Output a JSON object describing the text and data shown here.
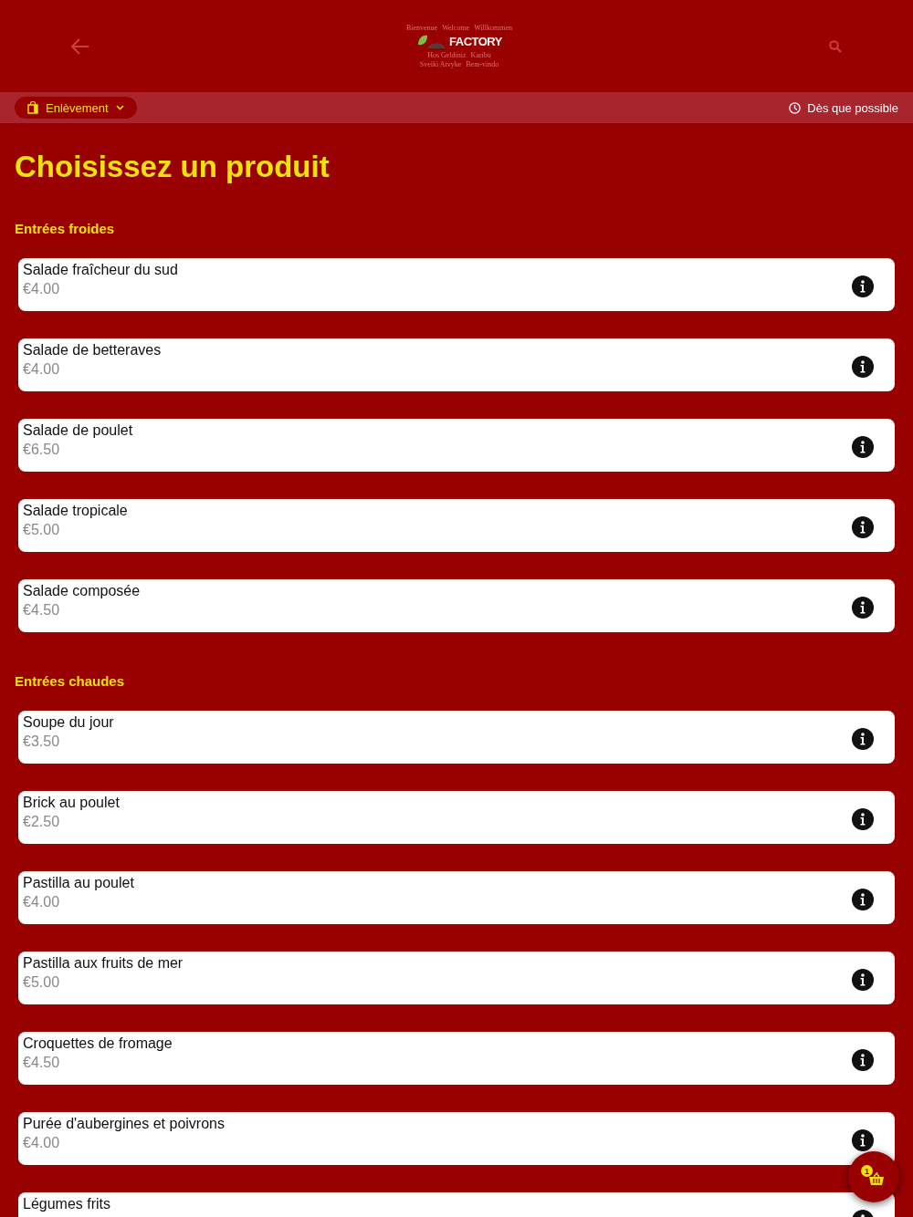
{
  "header": {
    "logo": {
      "brand": "FACTORY",
      "words": [
        "Bienvenue",
        "Welcome",
        "Willkommen",
        "Hos Geldiniz",
        "Karibu",
        "Sveiki Atvyke",
        "Bem-vindo"
      ]
    }
  },
  "toolbar": {
    "mode": "Enlèvement",
    "time": "Dès que possible"
  },
  "title": "Choisissez un produit",
  "sections": [
    {
      "title": "Entrées froides",
      "items": [
        {
          "name": "Salade fraîcheur du sud",
          "price": "€4.00"
        },
        {
          "name": "Salade de betteraves",
          "price": "€4.00"
        },
        {
          "name": "Salade de poulet",
          "price": "€6.50"
        },
        {
          "name": "Salade tropicale",
          "price": "€5.00"
        },
        {
          "name": "Salade composée",
          "price": "€4.50"
        }
      ]
    },
    {
      "title": "Entrées chaudes",
      "items": [
        {
          "name": "Soupe du jour",
          "price": "€3.50"
        },
        {
          "name": "Brick au poulet",
          "price": "€2.50"
        },
        {
          "name": "Pastilla au poulet",
          "price": "€4.00"
        },
        {
          "name": "Pastilla aux fruits de mer",
          "price": "€5.00"
        },
        {
          "name": "Croquettes de fromage",
          "price": "€4.50"
        },
        {
          "name": "Purée d'aubergines et poivrons",
          "price": "€4.00"
        },
        {
          "name": "Légumes frits"
        }
      ]
    }
  ],
  "cart": {
    "count": "1"
  }
}
